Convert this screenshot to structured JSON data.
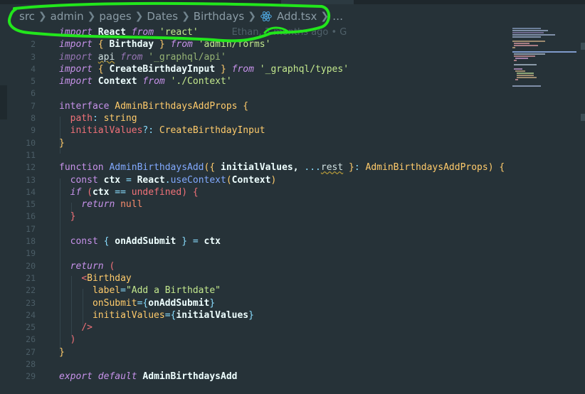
{
  "breadcrumb": [
    "src",
    "admin",
    "pages",
    "Dates",
    "Birthdays",
    "Add.tsx",
    "…"
  ],
  "blame": "Ethan, 3 months ago • G",
  "line_numbers": [
    "2",
    "3",
    "4",
    "5",
    "6",
    "7",
    "8",
    "9",
    "10",
    "11",
    "12",
    "13",
    "14",
    "15",
    "16",
    "17",
    "18",
    "19",
    "20",
    "21",
    "22",
    "23",
    "24",
    "25",
    "26",
    "27",
    "28",
    "29"
  ],
  "code": {
    "l1": {
      "kw1": "import",
      "name": "React",
      "kw2": "from",
      "str": "'react'"
    },
    "l2": {
      "kw1": "import",
      "open": "{",
      "name": "Birthday",
      "close": "}",
      "kw2": "from",
      "str": "'admin/forms'"
    },
    "l3": {
      "kw1": "import",
      "name": "api",
      "kw2": "from",
      "str": "'_graphql/api'"
    },
    "l4": {
      "kw1": "import",
      "open": "{",
      "name": "CreateBirthdayInput",
      "close": "}",
      "kw2": "from",
      "str": "'_graphql/types'"
    },
    "l5": {
      "kw1": "import",
      "name": "Context",
      "kw2": "from",
      "str": "'./Context'"
    },
    "l7": {
      "kw": "interface",
      "name": "AdminBirthdaysAddProps",
      "open": "{"
    },
    "l8": {
      "prop": "path",
      "colon": ":",
      "type": "string"
    },
    "l9": {
      "prop": "initialValues",
      "opt": "?:",
      "type": "CreateBirthdayInput"
    },
    "l10": {
      "close": "}"
    },
    "l12": {
      "kw": "function",
      "name": "AdminBirthdaysAdd",
      "paren": "(",
      "brace": "{",
      "arg": "initialValues,",
      "spread": "...",
      "rest": "rest",
      "brace2": "}",
      "colon": ":",
      "type": "AdminBirthdaysAddProps",
      "end": ")",
      "open": "{"
    },
    "l13": {
      "kw": "const",
      "name": "ctx",
      "eq": "=",
      "obj": "React",
      "dot": ".",
      "fn": "useContext",
      "p1": "(",
      "arg": "Context",
      "p2": ")"
    },
    "l14": {
      "kw": "if",
      "p1": "(",
      "name": "ctx",
      "op": "==",
      "val": "undefined",
      "p2": ")",
      "open": "{"
    },
    "l15": {
      "kw": "return",
      "val": "null"
    },
    "l16": {
      "close": "}"
    },
    "l18": {
      "kw": "const",
      "open": "{",
      "name": "onAddSubmit",
      "close": "}",
      "eq": "=",
      "obj": "ctx"
    },
    "l20": {
      "kw": "return",
      "p": "("
    },
    "l21": {
      "lt": "<",
      "tag": "Birthday"
    },
    "l22": {
      "attr": "label",
      "eq": "=",
      "str": "\"Add a Birthdate\""
    },
    "l23": {
      "attr": "onSubmit",
      "eq": "=",
      "o": "{",
      "val": "onAddSubmit",
      "c": "}"
    },
    "l24": {
      "attr": "initialValues",
      "eq": "=",
      "o": "{",
      "val": "initialValues",
      "c": "}"
    },
    "l25": {
      "close": "/>"
    },
    "l26": {
      "p": ")"
    },
    "l27": {
      "close": "}"
    },
    "l29": {
      "kw1": "export",
      "kw2": "default",
      "name": "AdminBirthdaysAdd"
    }
  }
}
